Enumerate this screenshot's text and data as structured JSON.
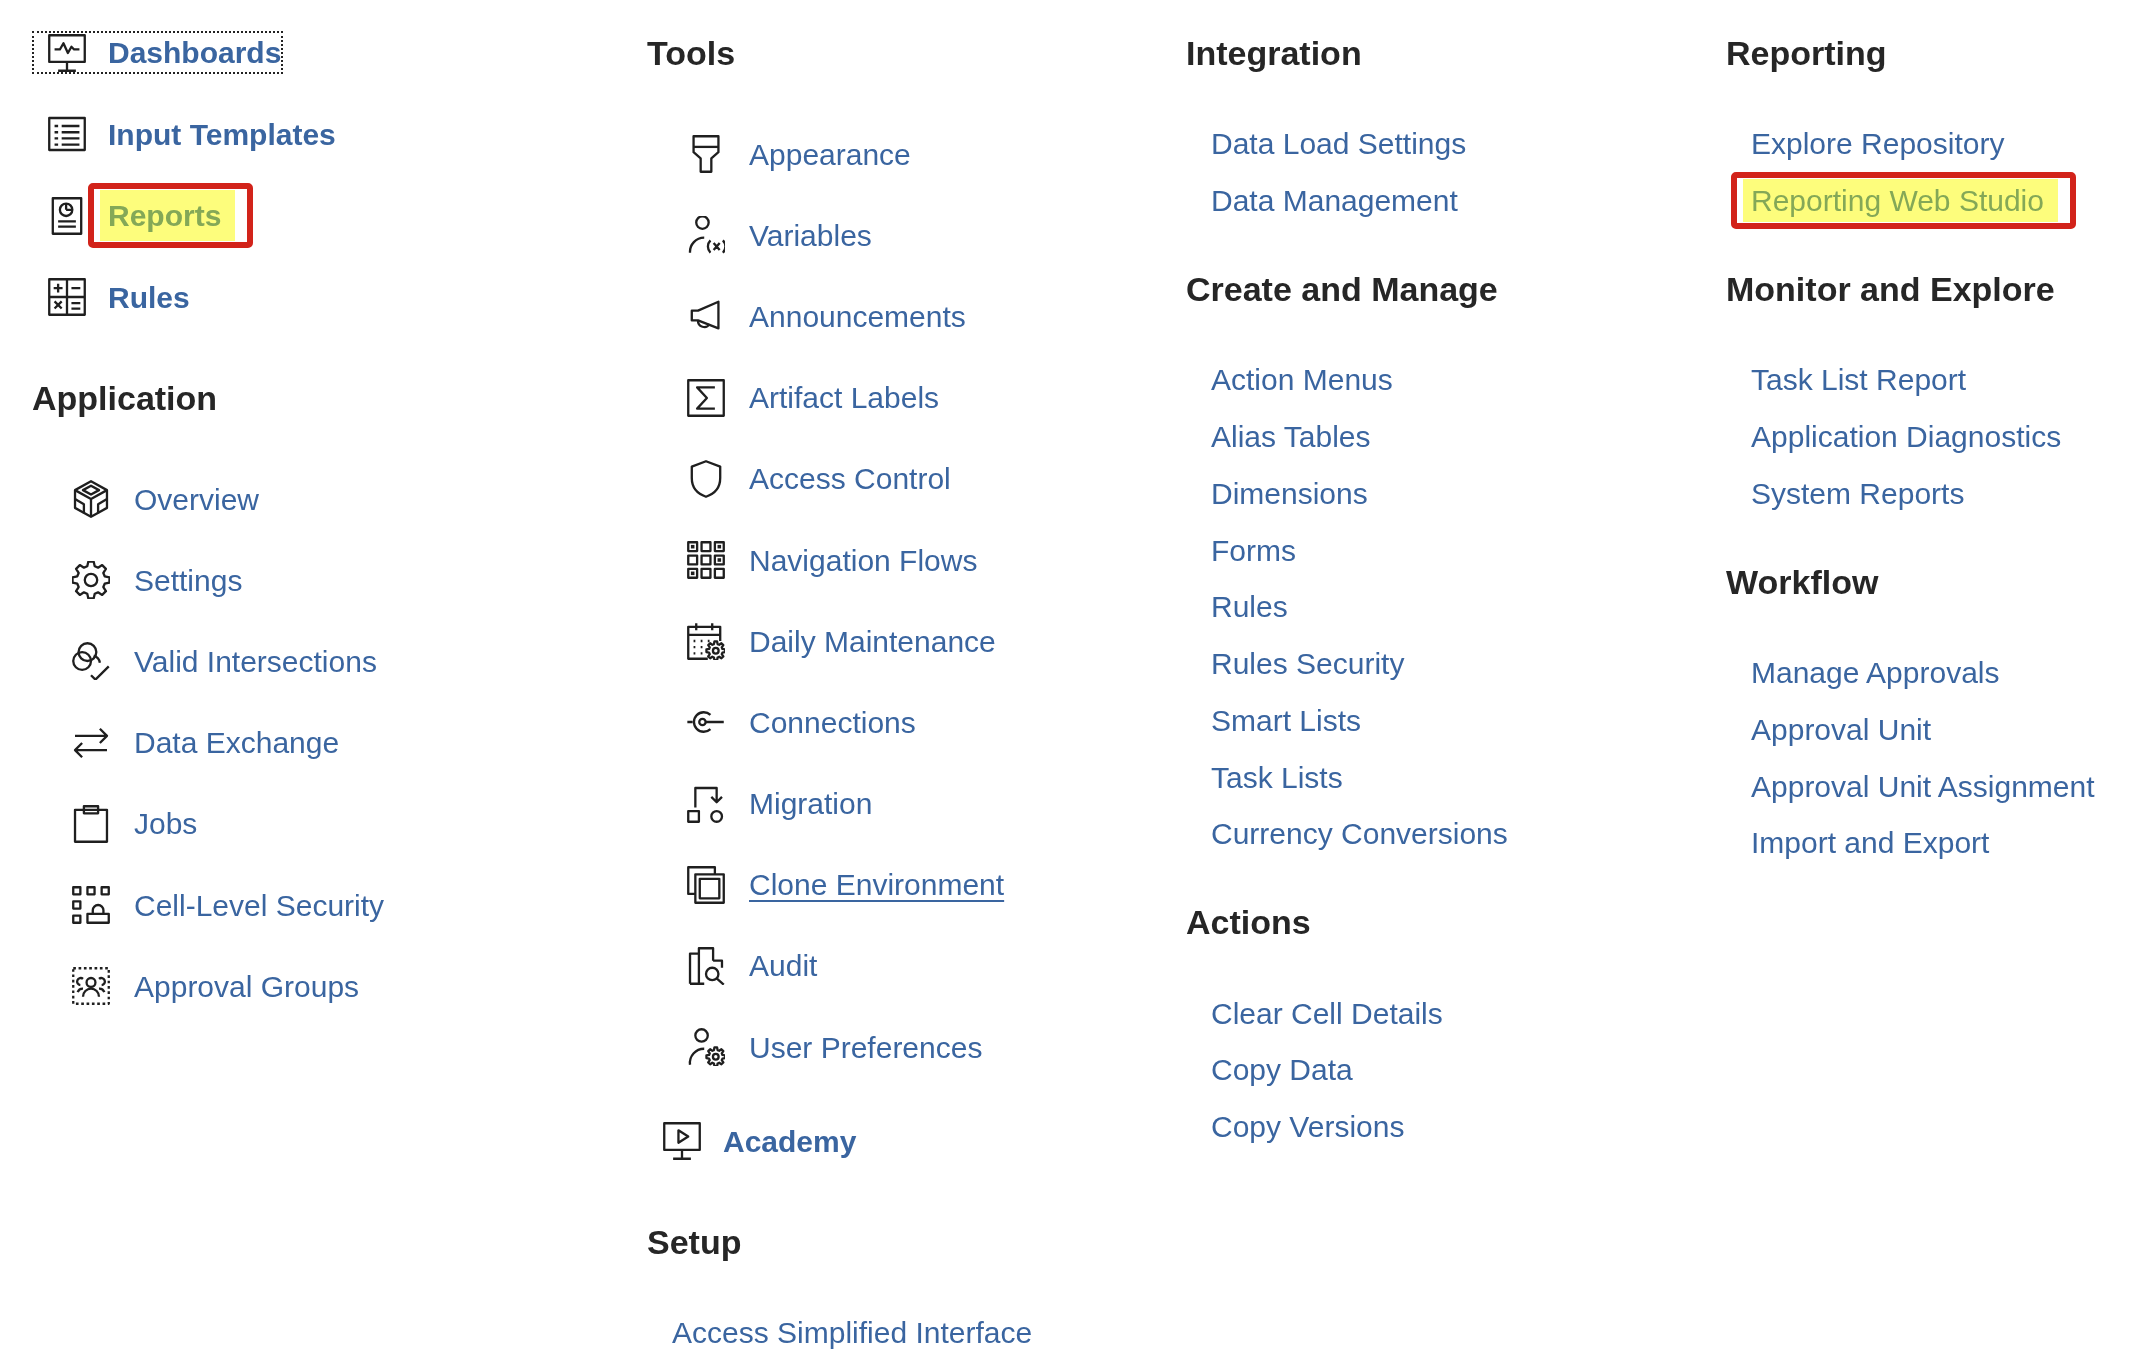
{
  "columns": [
    {
      "sections": [
        {
          "kind": "primary",
          "items": [
            {
              "label": "Dashboards",
              "focused": true,
              "highlighted": false
            },
            {
              "label": "Input Templates",
              "focused": false,
              "highlighted": false
            },
            {
              "label": "Reports",
              "focused": false,
              "highlighted": true
            },
            {
              "label": "Rules",
              "focused": false,
              "highlighted": false
            }
          ]
        },
        {
          "kind": "iconed",
          "heading": "Application",
          "items": [
            {
              "label": "Overview"
            },
            {
              "label": "Settings"
            },
            {
              "label": "Valid Intersections"
            },
            {
              "label": "Data Exchange"
            },
            {
              "label": "Jobs"
            },
            {
              "label": "Cell-Level Security"
            },
            {
              "label": "Approval Groups"
            }
          ]
        }
      ]
    },
    {
      "sections": [
        {
          "kind": "iconed",
          "heading": "Tools",
          "items": [
            {
              "label": "Appearance",
              "hovered": false
            },
            {
              "label": "Variables",
              "hovered": false
            },
            {
              "label": "Announcements",
              "hovered": false
            },
            {
              "label": "Artifact Labels",
              "hovered": false
            },
            {
              "label": "Access Control",
              "hovered": false
            },
            {
              "label": "Navigation Flows",
              "hovered": false
            },
            {
              "label": "Daily Maintenance",
              "hovered": false
            },
            {
              "label": "Connections",
              "hovered": false
            },
            {
              "label": "Migration",
              "hovered": false
            },
            {
              "label": "Clone Environment",
              "hovered": true
            },
            {
              "label": "Audit",
              "hovered": false
            },
            {
              "label": "User Preferences",
              "hovered": false
            }
          ]
        },
        {
          "kind": "primary",
          "items": [
            {
              "label": "Academy"
            }
          ]
        },
        {
          "kind": "plain",
          "heading": "Setup",
          "items": [
            {
              "label": "Access Simplified Interface"
            }
          ]
        }
      ]
    },
    {
      "sections": [
        {
          "kind": "plain",
          "heading": "Integration",
          "items": [
            {
              "label": "Data Load Settings"
            },
            {
              "label": "Data Management"
            }
          ]
        },
        {
          "kind": "plain",
          "heading": "Create and Manage",
          "items": [
            {
              "label": "Action Menus"
            },
            {
              "label": "Alias Tables"
            },
            {
              "label": "Dimensions"
            },
            {
              "label": "Forms"
            },
            {
              "label": "Rules"
            },
            {
              "label": "Rules Security"
            },
            {
              "label": "Smart Lists"
            },
            {
              "label": "Task Lists"
            },
            {
              "label": "Currency Conversions"
            }
          ]
        },
        {
          "kind": "plain",
          "heading": "Actions",
          "items": [
            {
              "label": "Clear Cell Details"
            },
            {
              "label": "Copy Data"
            },
            {
              "label": "Copy Versions"
            }
          ]
        }
      ]
    },
    {
      "sections": [
        {
          "kind": "plain",
          "heading": "Reporting",
          "items": [
            {
              "label": "Explore Repository",
              "highlighted": false
            },
            {
              "label": "Reporting Web Studio",
              "highlighted": true
            }
          ]
        },
        {
          "kind": "plain",
          "heading": "Monitor and Explore",
          "items": [
            {
              "label": "Task List Report"
            },
            {
              "label": "Application Diagnostics"
            },
            {
              "label": "System Reports"
            }
          ]
        },
        {
          "kind": "plain",
          "heading": "Workflow",
          "items": [
            {
              "label": "Manage Approvals"
            },
            {
              "label": "Approval Unit"
            },
            {
              "label": "Approval Unit Assignment"
            },
            {
              "label": "Import and Export"
            }
          ]
        }
      ]
    }
  ]
}
